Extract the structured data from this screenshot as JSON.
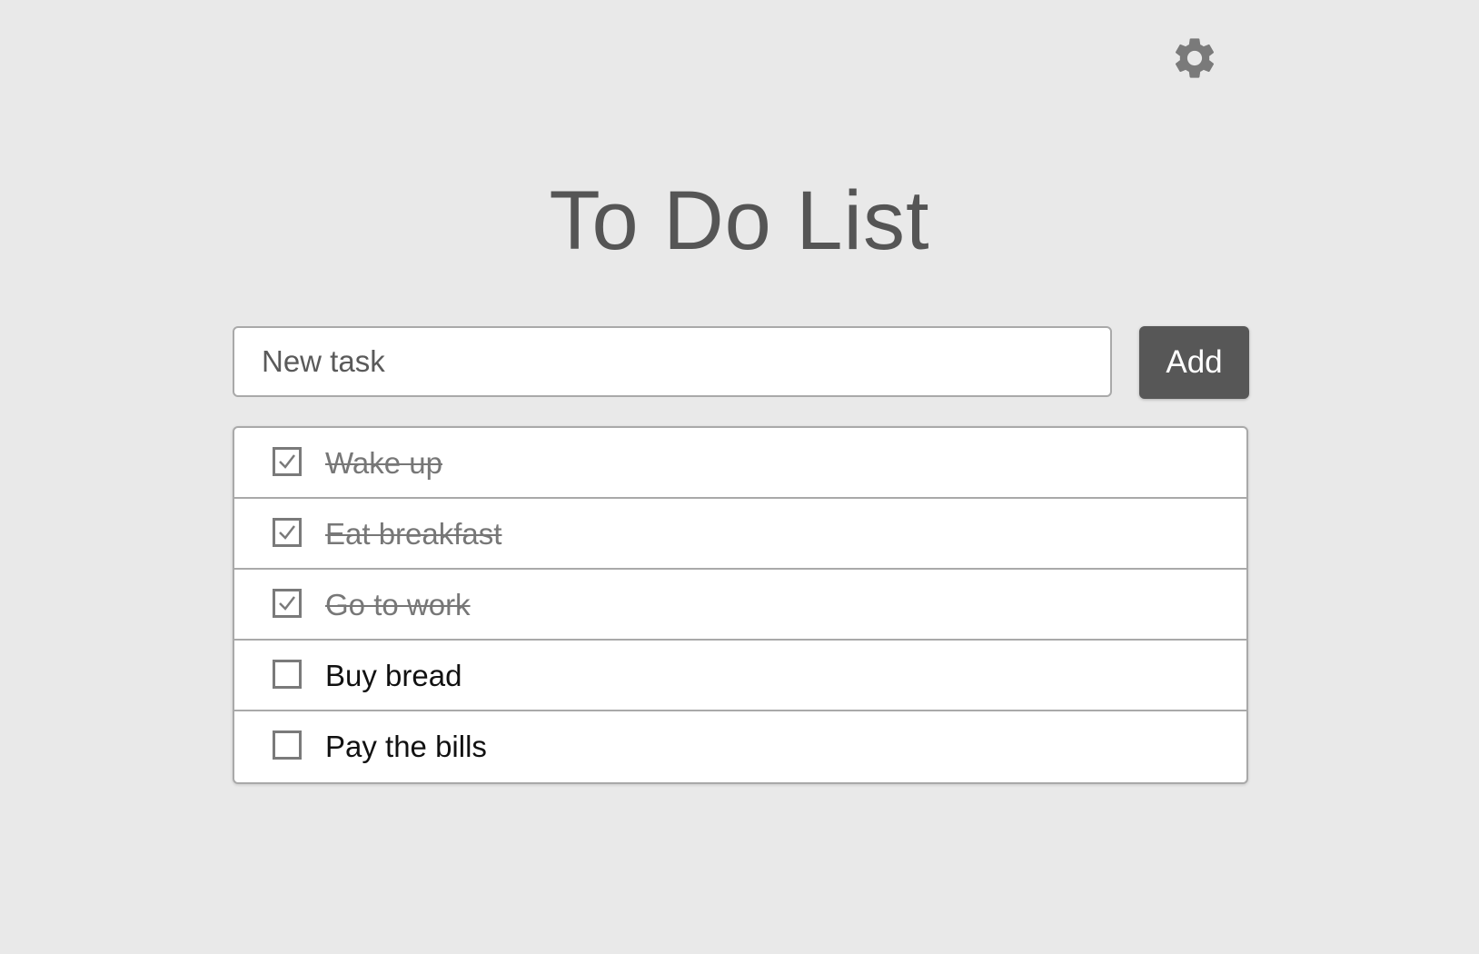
{
  "header": {
    "settings_icon": "gear-icon",
    "title": "To Do List"
  },
  "new_task": {
    "placeholder": "New task",
    "value": ""
  },
  "add_button": {
    "label": "Add"
  },
  "tasks": [
    {
      "label": "Wake up",
      "done": true
    },
    {
      "label": "Eat breakfast",
      "done": true
    },
    {
      "label": "Go to work",
      "done": true
    },
    {
      "label": "Buy bread",
      "done": false
    },
    {
      "label": "Pay the bills",
      "done": false
    }
  ],
  "colors": {
    "background": "#e9e9e9",
    "title": "#555555",
    "button": "#575757",
    "border": "#a9a9a9",
    "done_text": "#777777"
  }
}
